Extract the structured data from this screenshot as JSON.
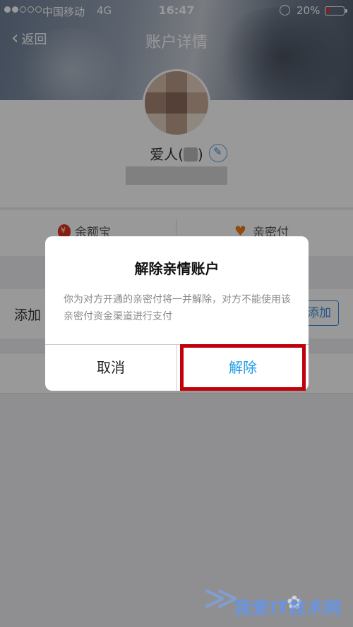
{
  "status_bar": {
    "carrier": "中国移动",
    "network": "4G",
    "time": "16:47",
    "battery": "20%",
    "battery_level": 0.2,
    "signal_bars_filled": 2,
    "signal_bars_total": 5
  },
  "nav": {
    "back_label": "返回",
    "title": "账户详情"
  },
  "profile": {
    "name_prefix": "爱人(",
    "name_suffix": ")"
  },
  "entries": [
    {
      "label": "余额宝",
      "icon": "money-bag-icon"
    },
    {
      "label": "亲密付",
      "icon": "heart-icon"
    }
  ],
  "add_row": {
    "label": "添加",
    "button_label": "添加"
  },
  "dialog": {
    "title": "解除亲情账户",
    "message": "你为对方开通的亲密付将一并解除，对方不能使用该亲密付资金渠道进行支付",
    "cancel_label": "取消",
    "confirm_label": "解除"
  },
  "watermark": {
    "text": "我爱IT技术网"
  },
  "colors": {
    "accent": "#1e9be6",
    "highlight": "#c0000b"
  }
}
